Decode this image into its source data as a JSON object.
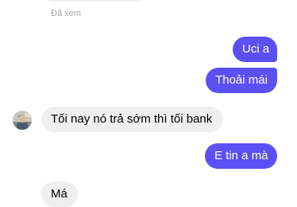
{
  "conversation": {
    "status": "Đã xem",
    "messages": [
      {
        "direction": "out",
        "text": "Uci a"
      },
      {
        "direction": "out",
        "text": "Thoải mái"
      },
      {
        "direction": "in",
        "text": "Tối nay nó trả sớm thì tối bank"
      },
      {
        "direction": "out",
        "text": "E tin a mà"
      },
      {
        "direction": "in",
        "text": "Má"
      }
    ]
  },
  "colors": {
    "outgoing_bubble": "#5b50f4",
    "incoming_bubble": "#efefef",
    "seen_text": "#a3a3a3"
  },
  "icons": {
    "contact_avatar": "avatar"
  }
}
